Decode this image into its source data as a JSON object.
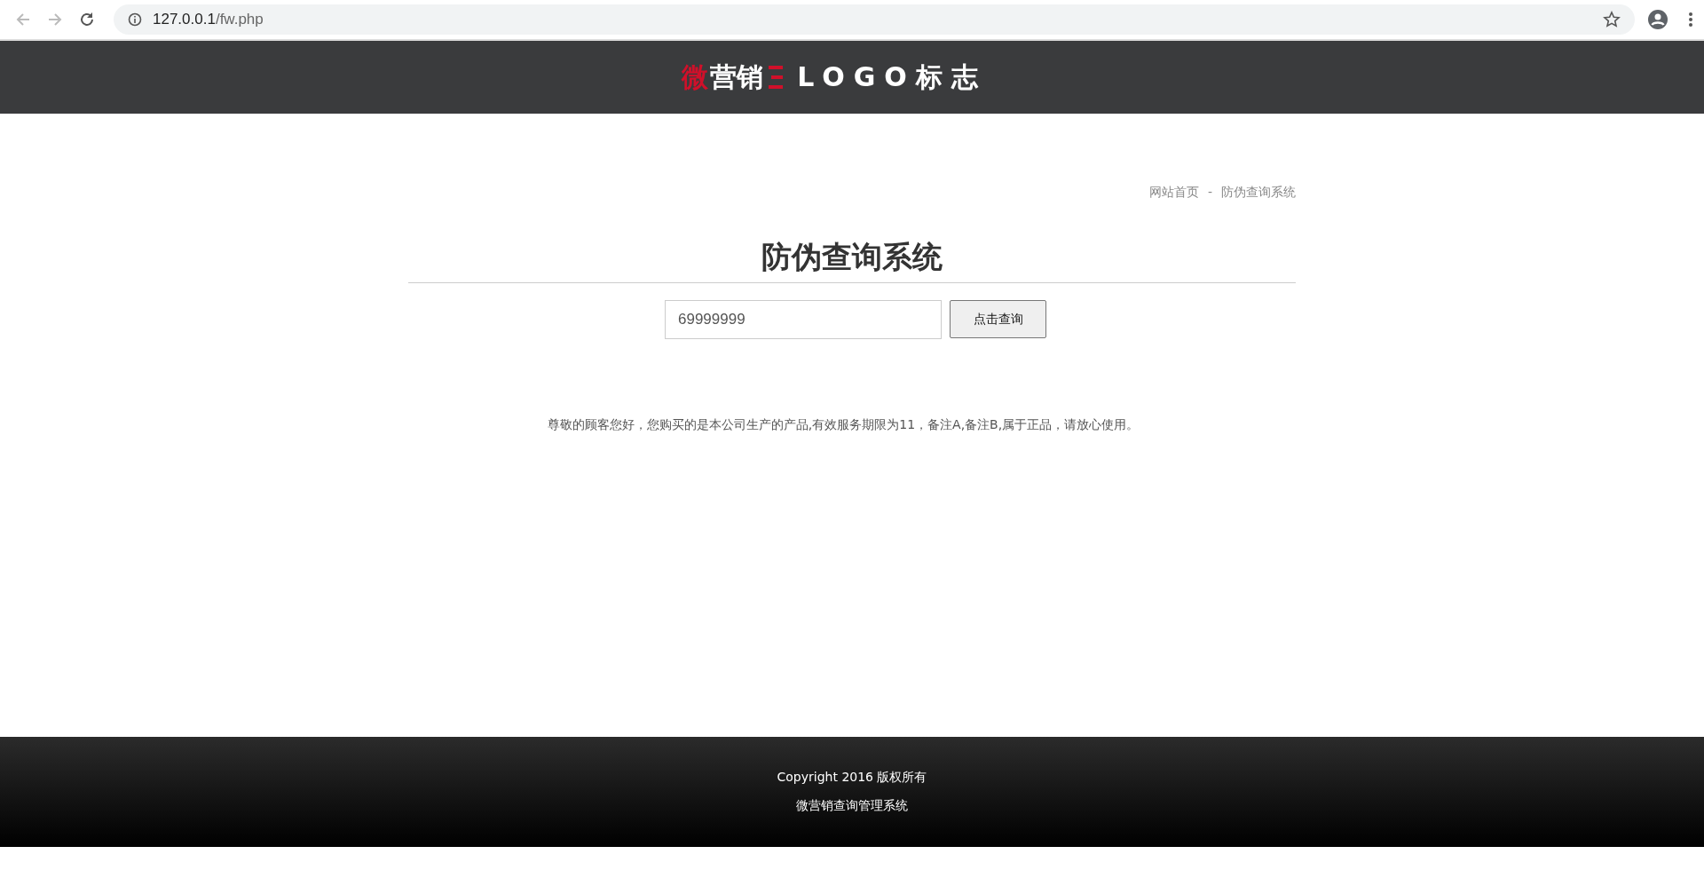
{
  "browser": {
    "url_host": "127.0.0.1",
    "url_path": "/fw.php"
  },
  "logo": {
    "accent": "微",
    "text": "营销",
    "brand": "LOGO标志"
  },
  "breadcrumb": [
    {
      "label": "网站首页"
    },
    {
      "label": "防伪查询系统"
    }
  ],
  "breadcrumb_separator": "-",
  "title": "防伪查询系统",
  "search": {
    "value": "69999999",
    "button": "点击查询"
  },
  "result": "尊敬的顾客您好，您购买的是本公司生产的产品,有效服务期限为11，备注A,备注B,属于正品，请放心使用。",
  "footer": {
    "copyright": "Copyright 2016 版权所有",
    "system": "微营销查询管理系统"
  }
}
